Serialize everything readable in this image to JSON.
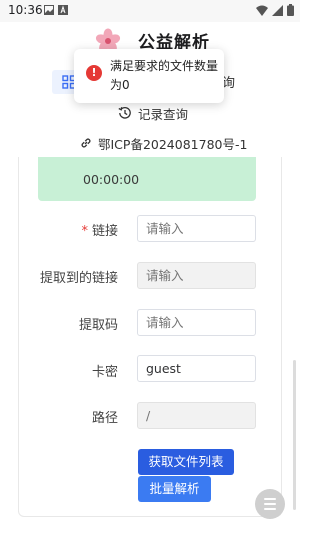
{
  "status_bar": {
    "time": "10:36",
    "icons": [
      "image-icon",
      "text-a-icon",
      "wifi-icon",
      "signal-icon",
      "battery-icon"
    ]
  },
  "header": {
    "title": "公益解析",
    "logo_icon": "flower-logo-icon"
  },
  "nav": {
    "active_icon": "grid-icon",
    "right_text_partial": "询"
  },
  "record_link": {
    "icon": "history-icon",
    "label": "记录查询"
  },
  "icp_link": {
    "icon": "link-icon",
    "label": "鄂ICP备2024081780号-1"
  },
  "toast": {
    "icon": "error-icon",
    "message": "满足要求的文件数量为0"
  },
  "info_box": {
    "time": "00:00:00",
    "color": "#c8f0d6"
  },
  "form": {
    "fields": [
      {
        "label": "链接",
        "required": true,
        "placeholder": "请输入",
        "value": "",
        "disabled": false
      },
      {
        "label": "提取到的链接",
        "required": false,
        "placeholder": "请输入",
        "value": "",
        "disabled": true
      },
      {
        "label": "提取码",
        "required": false,
        "placeholder": "请输入",
        "value": "",
        "disabled": false
      },
      {
        "label": "卡密",
        "required": false,
        "placeholder": "",
        "value": "guest",
        "disabled": false
      },
      {
        "label": "路径",
        "required": false,
        "placeholder": "/",
        "value": "",
        "disabled": true
      }
    ],
    "required_mark": "*",
    "buttons": {
      "get_list": "获取文件列表",
      "batch_parse": "批量解析"
    }
  },
  "fab": {
    "icon": "menu-icon"
  },
  "colors": {
    "primary": "#2a5de0",
    "batch": "#3b7bf2",
    "error": "#e53935",
    "nav_active_bg": "#ecf2fe"
  }
}
